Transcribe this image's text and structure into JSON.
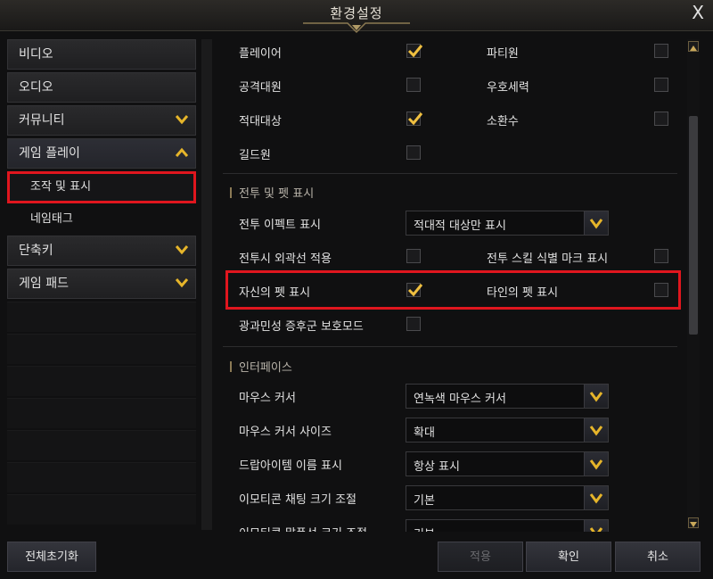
{
  "window": {
    "title": "환경설정",
    "close_label": "X"
  },
  "sidebar": {
    "items": [
      {
        "label": "비디오"
      },
      {
        "label": "오디오"
      },
      {
        "label": "커뮤니티"
      },
      {
        "label": "게임 플레이"
      },
      {
        "label": "조작 및 표시"
      },
      {
        "label": "네임태그"
      },
      {
        "label": "단축키"
      },
      {
        "label": "게임 패드"
      }
    ]
  },
  "main": {
    "name_rows": [
      {
        "left": "플레이어",
        "left_checked": true,
        "right": "파티원",
        "right_checked": false
      },
      {
        "left": "공격대원",
        "left_checked": false,
        "right": "우호세력",
        "right_checked": false
      },
      {
        "left": "적대대상",
        "left_checked": true,
        "right": "소환수",
        "right_checked": false
      },
      {
        "left": "길드원",
        "left_checked": false
      }
    ],
    "combat_section": "전투 및 펫 표시",
    "combat_effect": {
      "label": "전투 이펙트 표시",
      "value": "적대적 대상만 표시"
    },
    "combat_outline": {
      "label": "전투시 외곽선 적용",
      "checked": false
    },
    "skill_mark": {
      "label": "전투 스킬 식별 마크 표시",
      "checked": false
    },
    "own_pet": {
      "label": "자신의 펫 표시",
      "checked": true
    },
    "other_pet": {
      "label": "타인의 펫 표시",
      "checked": false
    },
    "photosensitive": {
      "label": "광과민성 증후군 보호모드",
      "checked": false
    },
    "interface_section": "인터페이스",
    "mouse_cursor": {
      "label": "마우스 커서",
      "value": "연녹색 마우스 커서"
    },
    "cursor_size": {
      "label": "마우스 커서 사이즈",
      "value": "확대"
    },
    "drop_item_name": {
      "label": "드랍아이템 이름 표시",
      "value": "항상 표시"
    },
    "emoticon_chat_size": {
      "label": "이모티콘 채팅 크기 조절",
      "value": "기본"
    },
    "emoticon_bubble_size": {
      "label": "이모티콘 말풍선 크기 조절",
      "value": "기본"
    }
  },
  "footer": {
    "reset_label": "전체초기화",
    "apply_label": "적용",
    "ok_label": "확인",
    "cancel_label": "취소"
  },
  "colors": {
    "highlight": "#e0161e",
    "check": "#f0c040",
    "chevron": "#e6b52a"
  }
}
